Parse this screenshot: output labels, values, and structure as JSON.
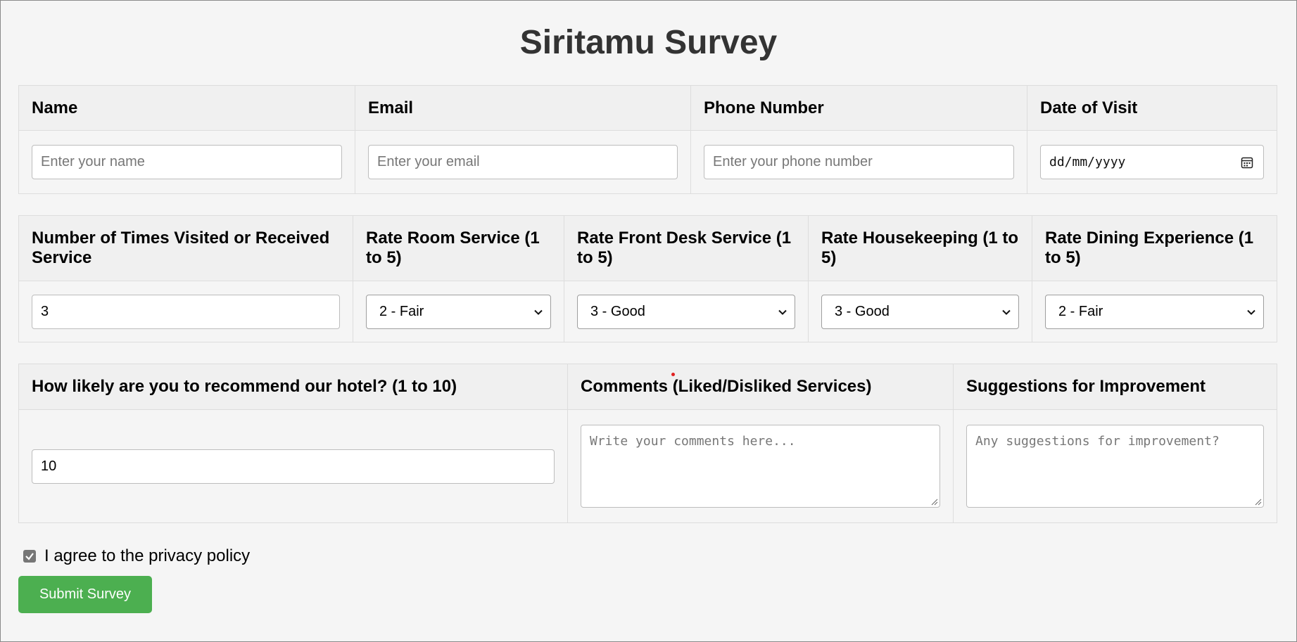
{
  "title": "Siritamu Survey",
  "contact": {
    "headers": [
      "Name",
      "Email",
      "Phone Number",
      "Date of Visit"
    ],
    "name_placeholder": "Enter your name",
    "email_placeholder": "Enter your email",
    "phone_placeholder": "Enter your phone number",
    "date_value": "dd/mm/yyyy"
  },
  "ratings": {
    "headers": [
      "Number of Times Visited or Received Service",
      "Rate Room Service (1 to 5)",
      "Rate Front Desk Service (1 to 5)",
      "Rate Housekeeping (1 to 5)",
      "Rate Dining Experience (1 to 5)"
    ],
    "visits_value": "3",
    "room_service": "2 - Fair",
    "front_desk": "3 - Good",
    "housekeeping": "3 - Good",
    "dining": "2 - Fair"
  },
  "feedback": {
    "headers": [
      "How likely are you to recommend our hotel? (1 to 10)",
      "Comments (Liked/Disliked Services)",
      "Suggestions for Improvement"
    ],
    "recommend_value": "10",
    "comments_placeholder": "Write your comments here...",
    "suggestions_placeholder": "Any suggestions for improvement?"
  },
  "privacy": {
    "label": "I agree to the privacy policy",
    "checked": true
  },
  "submit_label": "Submit Survey",
  "icons": {
    "date": "calendar-icon",
    "select": "chevron-down-icon",
    "checkbox": "checkmark-icon"
  },
  "colors": {
    "submit_bg": "#4caf50",
    "title": "#333333"
  }
}
